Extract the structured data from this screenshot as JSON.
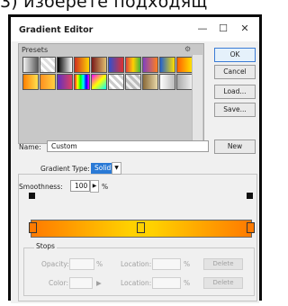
{
  "caption": "3) изберете подходящ",
  "window": {
    "title": "Gradient Editor",
    "minimize": "—",
    "maximize": "☐",
    "close": "✕"
  },
  "presets": {
    "label": "Presets",
    "menu_icon": "gear-icon"
  },
  "buttons": {
    "ok": "OK",
    "cancel": "Cancel",
    "load": "Load...",
    "save": "Save...",
    "new": "New"
  },
  "name": {
    "label": "Name:",
    "value": "Custom"
  },
  "gradient_type": {
    "label": "Gradient Type:",
    "value": "Solid"
  },
  "smoothness": {
    "label": "Smoothness:",
    "value": "100",
    "unit": "%"
  },
  "stops": {
    "label": "Stops",
    "opacity_label": "Opacity:",
    "opacity_unit": "%",
    "location_label": "Location:",
    "location_unit": "%",
    "color_label": "Color:",
    "delete_label": "Delete"
  },
  "gradient": {
    "start_color": "#ff7a00",
    "mid_color": "#ffd100",
    "end_color": "#ff7a00"
  },
  "swatch_colors": [
    "#e8e8e8",
    "#3a3a3a",
    "#ffffff",
    "#bdbdbd",
    "#c46a2c",
    "#3f6fd0",
    "#c2b14a",
    "#9b4e3b",
    "#9a8bd0",
    "#5aa63a",
    "#ffb34d",
    "#ffb34d",
    "#7a4fd4",
    "#e35b3a",
    "#ffe24a",
    "#c8c8c8",
    "#b8b8b8",
    "#c9b57d",
    "#d6d6d6",
    "#b5b5b5"
  ]
}
